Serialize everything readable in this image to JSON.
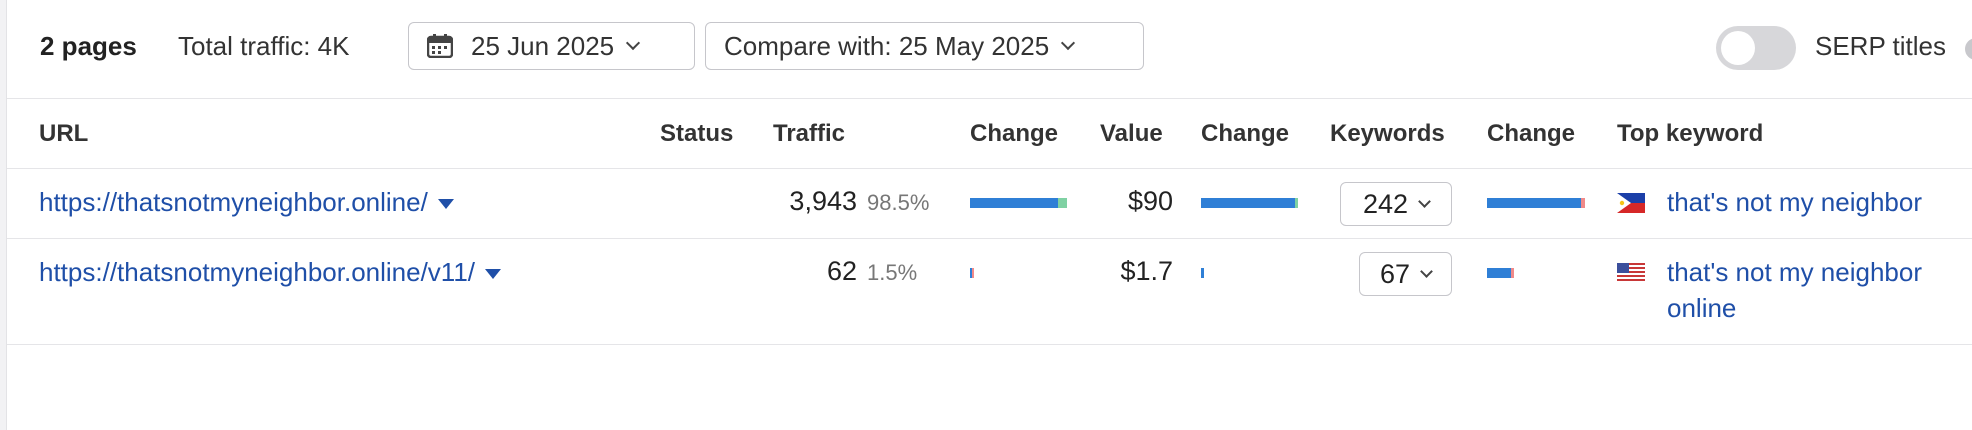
{
  "toolbar": {
    "pages_label": "2 pages",
    "total_traffic": "Total traffic: 4K",
    "date_label": "25 Jun 2025",
    "compare_label": "Compare with: 25 May 2025",
    "serp_titles_label": "SERP titles",
    "serp_titles_on": false
  },
  "columns": {
    "url": "URL",
    "status": "Status",
    "traffic": "Traffic",
    "traffic_change": "Change",
    "value": "Value",
    "value_change": "Change",
    "keywords": "Keywords",
    "keywords_change": "Change",
    "top_keyword": "Top keyword"
  },
  "rows": [
    {
      "url": "https://thatsnotmyneighbor.online/",
      "traffic": "3,943",
      "traffic_pct": "98.5%",
      "value": "$90",
      "keywords": "242",
      "top_keyword": "that's not my neighbor",
      "flag": "philippines-flag-icon"
    },
    {
      "url": "https://thatsnotmyneighbor.online/v11/",
      "traffic": "62",
      "traffic_pct": "1.5%",
      "value": "$1.7",
      "keywords": "67",
      "top_keyword": "that's not my neighbor online",
      "flag": "us-flag-icon"
    }
  ],
  "colors": {
    "link": "#1f4fa8",
    "bar_blue": "#2f7fd6",
    "bar_green": "#7fd1a3",
    "bar_red": "#f08a8a"
  }
}
